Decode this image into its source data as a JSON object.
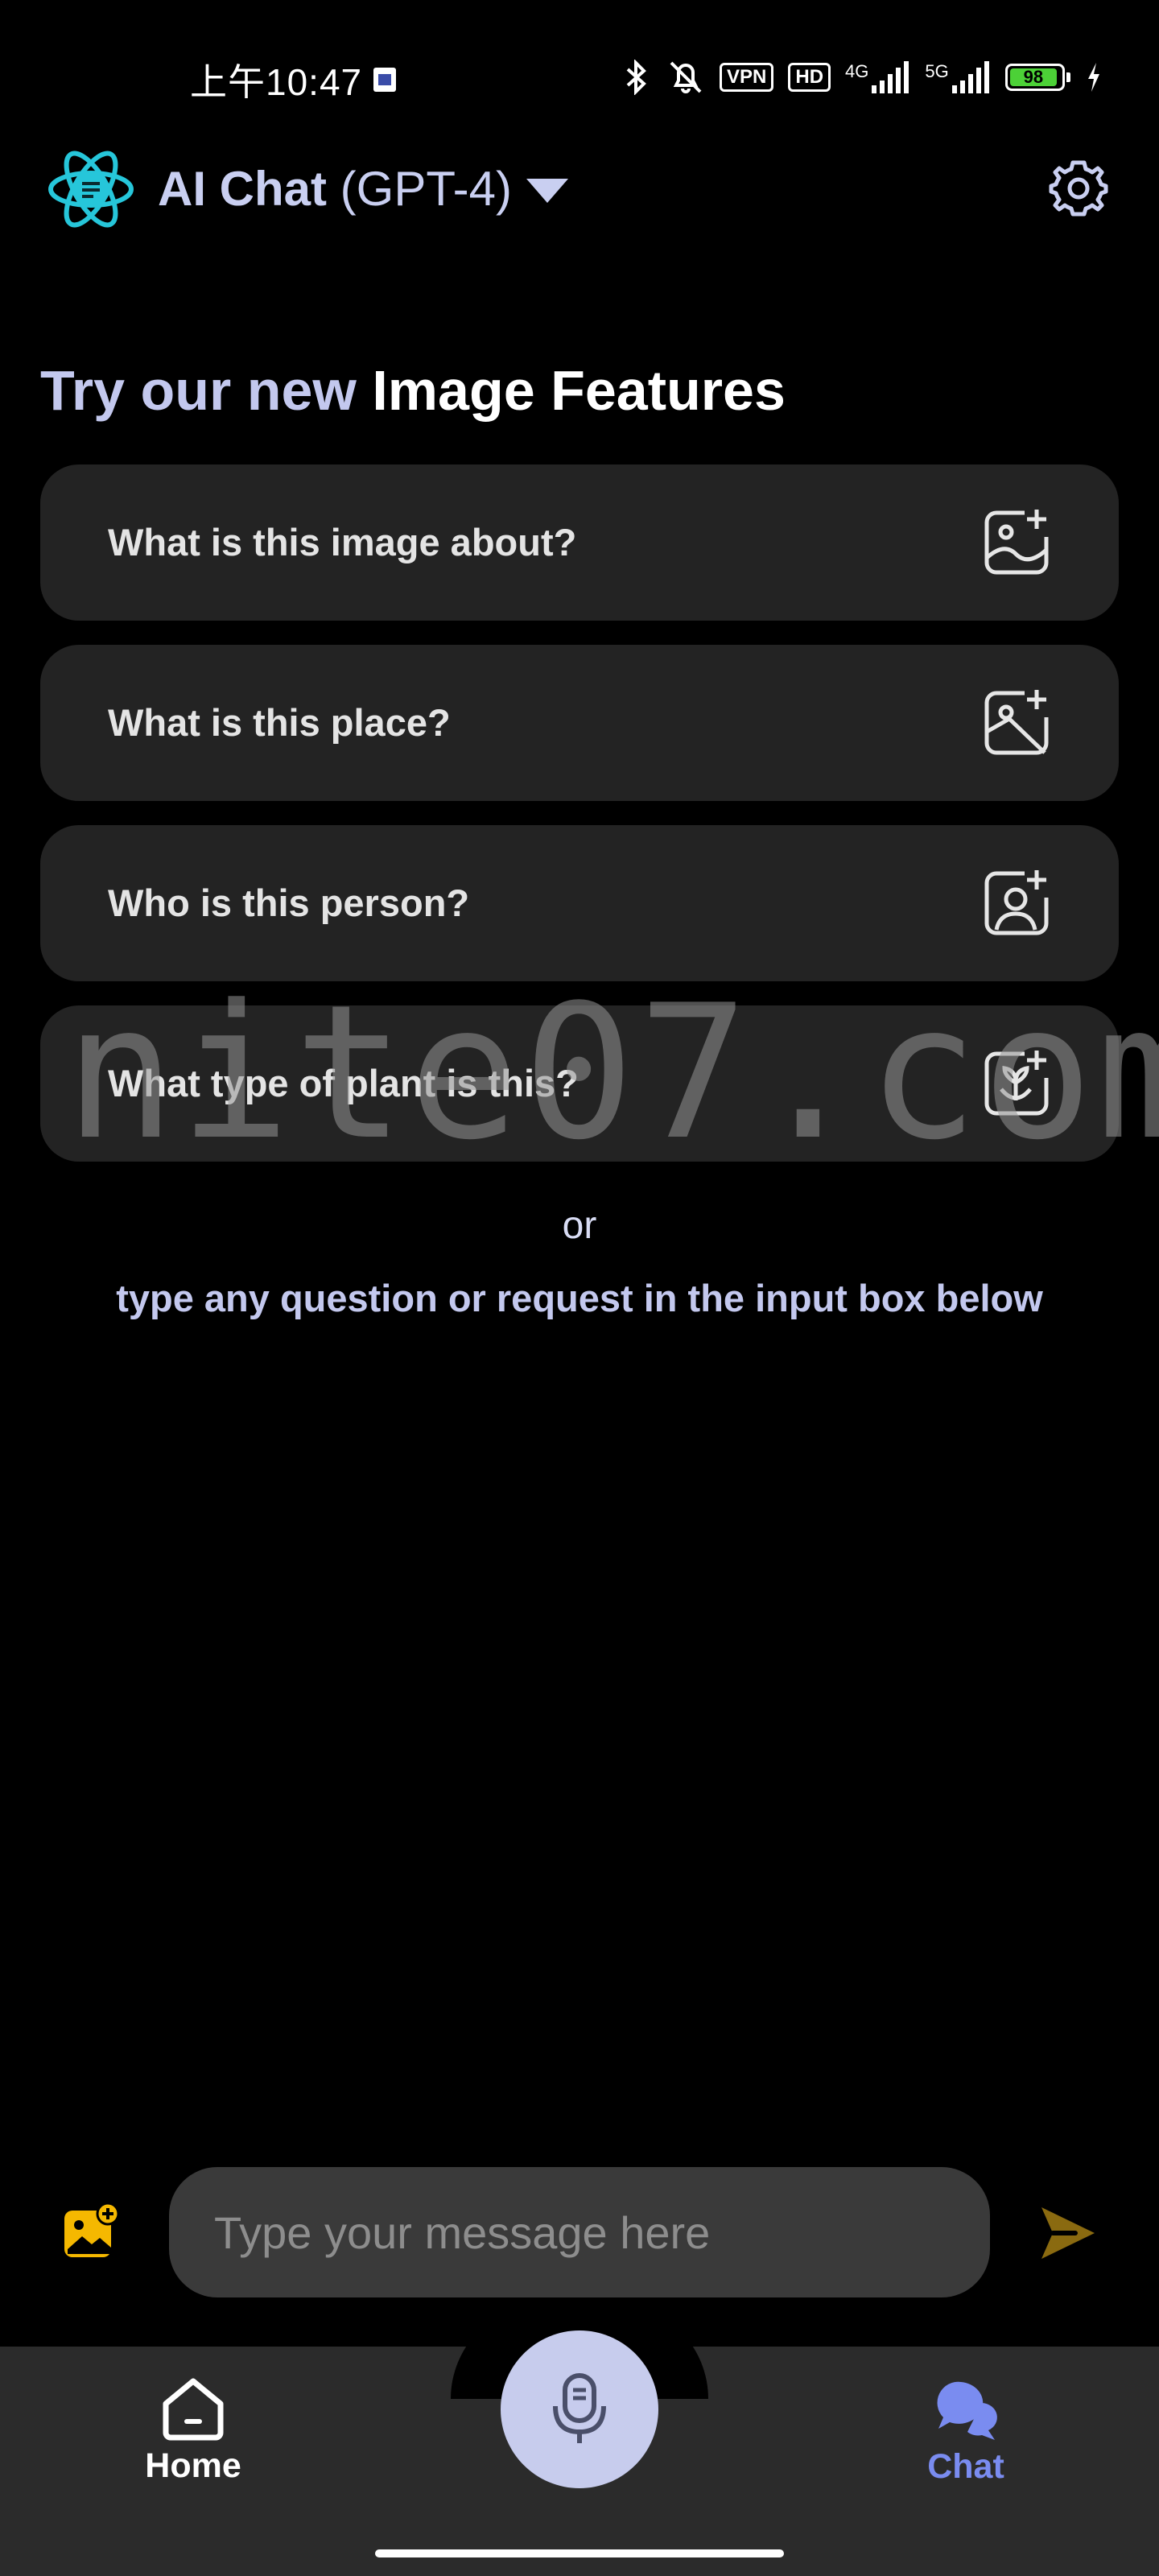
{
  "status_bar": {
    "time": "上午10:47",
    "vpn": "VPN",
    "hd": "HD",
    "net1": "4G",
    "net2": "5G",
    "battery": "98"
  },
  "header": {
    "title_bold": "AI Chat",
    "title_model": "(GPT-4)"
  },
  "section": {
    "title_light": "Try our new",
    "title_white": "Image Features"
  },
  "cards": [
    {
      "label": "What is this image about?",
      "icon": "image-add-icon"
    },
    {
      "label": "What is this place?",
      "icon": "location-image-icon"
    },
    {
      "label": "Who is this person?",
      "icon": "person-add-icon"
    },
    {
      "label": "What type of plant is this?",
      "icon": "plant-add-icon"
    }
  ],
  "or_text": "or",
  "hint_text": "type any question or request in the input box below",
  "watermark": "nite07.com",
  "input": {
    "placeholder": "Type your message here"
  },
  "nav": {
    "home_label": "Home",
    "chat_label": "Chat"
  },
  "colors": {
    "accent": "#7a8cf0",
    "logo": "#26c6da",
    "send": "#8a6a10",
    "image_button": "#f5b800"
  }
}
